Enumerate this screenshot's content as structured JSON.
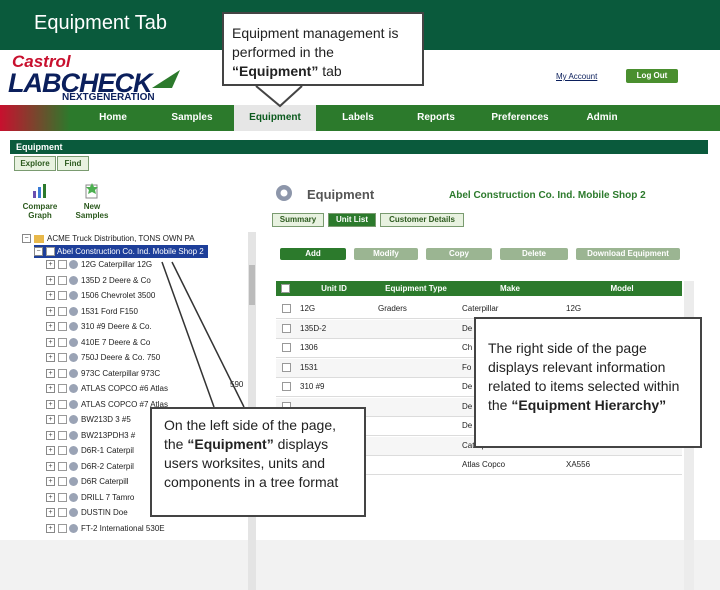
{
  "slide_title": "Equipment Tab",
  "logo": {
    "castrol": "Castrol",
    "labcheck": "LABCHECK",
    "nextgen": "NEXTGENERATION"
  },
  "header": {
    "my_account": "My Account",
    "log_out": "Log Out"
  },
  "nav": [
    {
      "label": "Home"
    },
    {
      "label": "Samples"
    },
    {
      "label": "Equipment"
    },
    {
      "label": "Labels"
    },
    {
      "label": "Reports"
    },
    {
      "label": "Preferences"
    },
    {
      "label": "Admin"
    }
  ],
  "section_title": "Equipment",
  "tabs": {
    "explore": "Explore",
    "find": "Find"
  },
  "tools": {
    "compare_graph": [
      "Compare",
      "Graph"
    ],
    "new_samples": [
      "New",
      "Samples"
    ]
  },
  "tree": {
    "root": "ACME Truck Distribution, TONS OWN PA",
    "selected": "Abel Construction Co. Ind. Mobile Shop 2",
    "items": [
      "12G Caterpillar 12G",
      "135D 2 Deere & Co",
      "1506 Chevrolet 3500",
      "1531 Ford F150",
      "310 #9 Deere & Co.",
      "410E 7 Deere & Co",
      "750J Deere & Co. 750",
      "973C Caterpillar 973C",
      "ATLAS COPCO #6 Atlas",
      "ATLAS COPCO #7 Atlas",
      "BW213D 3 #5",
      "BW213PDH3 #",
      "D6R-1 Caterpil",
      "D6R-2 Caterpil",
      "D6R Caterpill",
      "DRILL 7 Tamro",
      "DUSTIN Doe",
      "FT-2 International 530E"
    ],
    "side_fragment": "590"
  },
  "right": {
    "title": "Equipment",
    "subtitle": "Abel Construction Co. Ind. Mobile Shop 2",
    "subtabs": [
      "Summary",
      "Unit List",
      "Customer Details"
    ],
    "actions": [
      "Add",
      "Modify",
      "Copy",
      "Delete",
      "Download Equipment"
    ],
    "columns": [
      "Unit ID",
      "Equipment Type",
      "Make",
      "Model"
    ],
    "rows": [
      {
        "unit": "12G",
        "type": "Graders",
        "make": "Caterpillar",
        "model": "12G"
      },
      {
        "unit": "135D-2",
        "type": "",
        "make": "De",
        "model": ""
      },
      {
        "unit": "1306",
        "type": "",
        "make": "Ch",
        "model": ""
      },
      {
        "unit": "1531",
        "type": "",
        "make": "Fo",
        "model": ""
      },
      {
        "unit": "310 #9",
        "type": "",
        "make": "De",
        "model": ""
      },
      {
        "unit": "",
        "type": "",
        "make": "De",
        "model": ""
      },
      {
        "unit": "",
        "type": "",
        "make": "De",
        "model": ""
      },
      {
        "unit": "",
        "type": "",
        "make": "Caterpillar",
        "model": "973C"
      },
      {
        "unit": "",
        "type": "",
        "make": "Atlas Copco",
        "model": "XA556"
      }
    ]
  },
  "callouts": {
    "top": {
      "prefix": "Equipment management is performed in the ",
      "bold": "“Equipment”",
      "suffix": " tab"
    },
    "left": {
      "prefix": "On the left side of the page, the ",
      "bold": "“Equipment”",
      "suffix": " displays users worksites, units and components in a tree format"
    },
    "right": {
      "prefix": "The right side of the page displays relevant information related to items selected within the ",
      "bold": "“Equipment Hierarchy”",
      "suffix": ""
    }
  },
  "colors": {
    "title_bar": "#0a5a3c",
    "nav_green": "#2c7a2c",
    "brand_red": "#c8102e",
    "brand_navy": "#0b1f5c"
  }
}
